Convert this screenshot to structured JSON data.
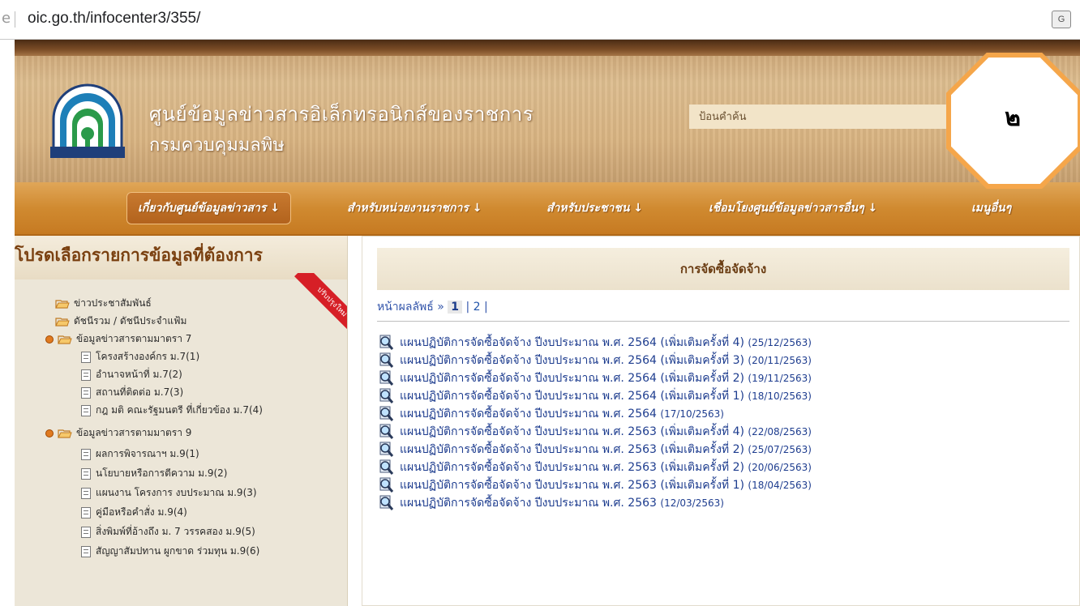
{
  "browser": {
    "url": "oic.go.th/infocenter3/355/"
  },
  "header": {
    "title": "ศูนย์ข้อมูลข่าวสารอิเล็กทรอนิกส์ของราชการ",
    "subtitle": "กรมควบคุมมลพิษ",
    "search_placeholder": "ป้อนคำค้น"
  },
  "nav": {
    "items": [
      "เกี่ยวกับศูนย์ข้อมูลข่าวสาร ↓",
      "สำหรับหน่วยงานราชการ ↓",
      "สำหรับประชาชน ↓",
      "เชื่อมโยงศูนย์ข้อมูลข่าวสารอื่นๆ ↓",
      "เมนูอื่นๆ"
    ]
  },
  "sidebar": {
    "title": "โปรดเลือกรายการข้อมูลที่ต้องการ",
    "ribbon": "ปรับปรุงใหม่",
    "items": [
      "ข่าวประชาสัมพันธ์",
      "ดัชนีรวม / ดัชนีประจำแฟ้ม",
      "ข้อมูลข่าวสารตามมาตรา 7",
      "โครงสร้างองค์กร ม.7(1)",
      "อำนาจหน้าที่ ม.7(2)",
      "สถานที่ติดต่อ ม.7(3)",
      "กฎ มติ คณะรัฐมนตรี ที่เกี่ยวข้อง ม.7(4)",
      "ข้อมูลข่าวสารตามมาตรา 9",
      "ผลการพิจารณาฯ ม.9(1)",
      "นโยบายหรือการตีความ ม.9(2)",
      "แผนงาน โครงการ งบประมาณ ม.9(3)",
      "คู่มือหรือคำสั่ง ม.9(4)",
      "สิ่งพิมพ์ที่อ้างถึง ม. 7 วรรคสอง ม.9(5)",
      "สัญญาสัมปทาน ผูกขาด ร่วมทุน ม.9(6)"
    ]
  },
  "content": {
    "title": "การจัดซื้อจัดจ้าง",
    "pager_label": "หน้าผลลัพธ์ »",
    "pager_current": "1",
    "pager_sep1": "|",
    "pager_page2": "2",
    "pager_sep2": "|",
    "docs": [
      {
        "text": "แผนปฏิบัติการจัดซื้อจัดจ้าง ปีงบประมาณ พ.ศ. 2564 (เพิ่มเติมครั้งที่ 4)",
        "date": "(25/12/2563)"
      },
      {
        "text": "แผนปฏิบัติการจัดซื้อจัดจ้าง ปีงบประมาณ พ.ศ. 2564 (เพิ่มเติมครั้งที่ 3)",
        "date": "(20/11/2563)"
      },
      {
        "text": "แผนปฏิบัติการจัดซื้อจัดจ้าง ปีงบประมาณ พ.ศ. 2564 (เพิ่มเติมครั้งที่ 2)",
        "date": "(19/11/2563)"
      },
      {
        "text": "แผนปฏิบัติการจัดซื้อจัดจ้าง ปีงบประมาณ พ.ศ. 2564 (เพิ่มเติมครั้งที่ 1)",
        "date": "(18/10/2563)"
      },
      {
        "text": "แผนปฏิบัติการจัดซื้อจัดจ้าง ปีงบประมาณ พ.ศ. 2564",
        "date": "(17/10/2563)"
      },
      {
        "text": "แผนปฏิบัติการจัดซื้อจัดจ้าง ปีงบประมาณ พ.ศ. 2563 (เพิ่มเติมครั้งที่ 4)",
        "date": "(22/08/2563)"
      },
      {
        "text": "แผนปฏิบัติการจัดซื้อจัดจ้าง ปีงบประมาณ พ.ศ. 2563 (เพิ่มเติมครั้งที่ 2)",
        "date": "(25/07/2563)"
      },
      {
        "text": "แผนปฏิบัติการจัดซื้อจัดจ้าง ปีงบประมาณ พ.ศ. 2563 (เพิ่มเติมครั้งที่ 2)",
        "date": "(20/06/2563)"
      },
      {
        "text": "แผนปฏิบัติการจัดซื้อจัดจ้าง ปีงบประมาณ พ.ศ. 2563 (เพิ่มเติมครั้งที่ 1)",
        "date": "(18/04/2563)"
      },
      {
        "text": "แผนปฏิบัติการจัดซื้อจัดจ้าง ปีงบประมาณ พ.ศ. 2563",
        "date": "(12/03/2563)"
      }
    ]
  },
  "overlay": {
    "label": "๒",
    "color": "#f5a64a"
  },
  "colors": {
    "nav": "#d08a30",
    "link": "#1e3d8f",
    "sidebar_title": "#7a4010"
  },
  "logo": {
    "text": "กรมควบคุมมลพิษ"
  }
}
